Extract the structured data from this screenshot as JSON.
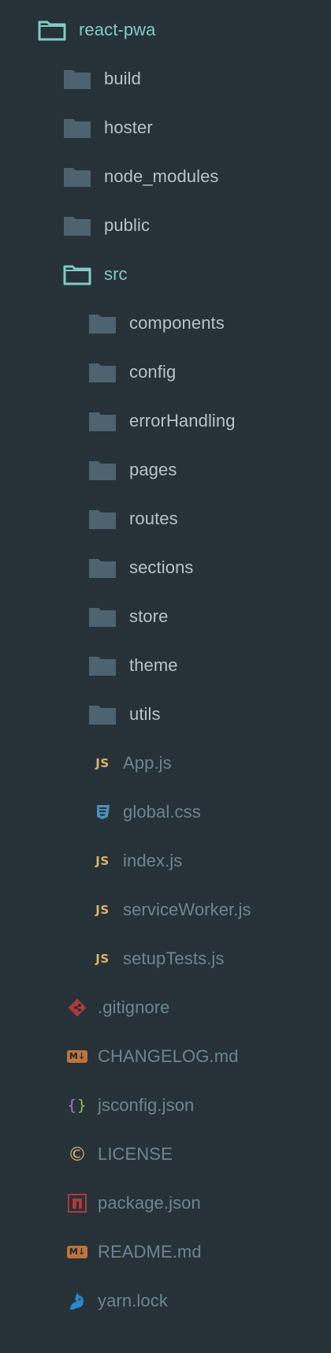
{
  "tree": {
    "root": {
      "label": "react-pwa",
      "icon": "folder-open-icon",
      "expanded": true
    },
    "folders_level1": [
      {
        "label": "build",
        "icon": "folder-icon"
      },
      {
        "label": "hoster",
        "icon": "folder-icon"
      },
      {
        "label": "node_modules",
        "icon": "folder-icon"
      },
      {
        "label": "public",
        "icon": "folder-icon"
      }
    ],
    "src": {
      "label": "src",
      "icon": "folder-open-icon",
      "expanded": true
    },
    "src_folders": [
      {
        "label": "components",
        "icon": "folder-icon"
      },
      {
        "label": "config",
        "icon": "folder-icon"
      },
      {
        "label": "errorHandling",
        "icon": "folder-icon"
      },
      {
        "label": "pages",
        "icon": "folder-icon"
      },
      {
        "label": "routes",
        "icon": "folder-icon"
      },
      {
        "label": "sections",
        "icon": "folder-icon"
      },
      {
        "label": "store",
        "icon": "folder-icon"
      },
      {
        "label": "theme",
        "icon": "folder-icon"
      },
      {
        "label": "utils",
        "icon": "folder-icon"
      }
    ],
    "src_files": [
      {
        "label": "App.js",
        "icon": "js-file-icon",
        "glyph": "JS"
      },
      {
        "label": "global.css",
        "icon": "css-file-icon"
      },
      {
        "label": "index.js",
        "icon": "js-file-icon",
        "glyph": "JS"
      },
      {
        "label": "serviceWorker.js",
        "icon": "js-file-icon",
        "glyph": "JS"
      },
      {
        "label": "setupTests.js",
        "icon": "js-file-icon",
        "glyph": "JS"
      }
    ],
    "root_files": [
      {
        "label": ".gitignore",
        "icon": "git-file-icon"
      },
      {
        "label": "CHANGELOG.md",
        "icon": "markdown-file-icon",
        "glyph": "M↓"
      },
      {
        "label": "jsconfig.json",
        "icon": "json-file-icon",
        "glyph": "{ }"
      },
      {
        "label": "LICENSE",
        "icon": "license-file-icon",
        "glyph": "©"
      },
      {
        "label": "package.json",
        "icon": "npm-file-icon"
      },
      {
        "label": "README.md",
        "icon": "markdown-file-icon",
        "glyph": "M↓"
      },
      {
        "label": "yarn.lock",
        "icon": "yarn-file-icon"
      }
    ]
  },
  "colors": {
    "background": "#263238",
    "folder_open": "#80CBC4",
    "folder_closed": "#4D6470",
    "folder_label": "#B6C3CA",
    "file_label": "#6E8590",
    "js": "#D9B36A",
    "css": "#4E8FB8",
    "git": "#B0383B",
    "markdown": "#C0733A",
    "npm": "#B0383B",
    "yarn": "#2D86C7"
  }
}
